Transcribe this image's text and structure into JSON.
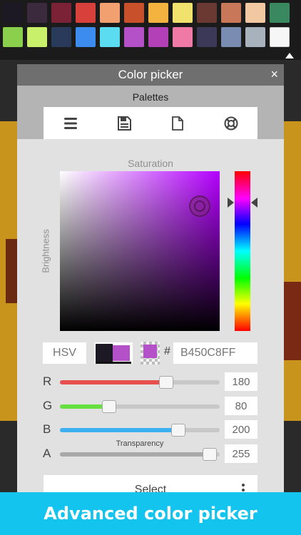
{
  "palette": {
    "row1": [
      "#1c1824",
      "#3b2a3e",
      "#7b2236",
      "#d8403c",
      "#f2a070",
      "#c8502a",
      "#f4b23e",
      "#f1e26e",
      "#6a3a32",
      "#c87858",
      "#f2c8a2",
      "#3a8860"
    ],
    "row2": [
      "#8ad04c",
      "#c8f06a",
      "#2a3a5a",
      "#3c8cf0",
      "#5cdcf0",
      "#b450c8",
      "#b440b8",
      "#f07aa6",
      "#3c3858",
      "#7a8cb2",
      "#a8b2bc",
      "#f6f6f6"
    ],
    "collapse_icon": "caret-up-icon"
  },
  "dialog": {
    "title": "Color picker",
    "close_glyph": "×",
    "palettes_label": "Palettes",
    "tools": [
      {
        "name": "list-icon"
      },
      {
        "name": "save-icon"
      },
      {
        "name": "new-file-icon"
      },
      {
        "name": "lifebuoy-icon"
      }
    ],
    "saturation_label": "Saturation",
    "brightness_label": "Brightness",
    "hue_color": "#b400ff",
    "mode": "HSV",
    "old_color": "#1c1824",
    "new_color": "#b450c8",
    "hash": "#",
    "hex_value": "B450C8FF",
    "channels": [
      {
        "label": "R",
        "value": "180",
        "level": 0.706,
        "color": "#e85050"
      },
      {
        "label": "G",
        "value": "80",
        "level": 0.314,
        "color": "#66e040"
      },
      {
        "label": "B",
        "value": "200",
        "level": 0.784,
        "color": "#3cb0f0"
      },
      {
        "label": "A",
        "value": "255",
        "level": 1.0,
        "color": "#a9a9a9"
      }
    ],
    "transparency_label": "Transparency",
    "select_label": "Select"
  },
  "banner": {
    "text": "Advanced color picker",
    "color": "#12c4ee"
  }
}
